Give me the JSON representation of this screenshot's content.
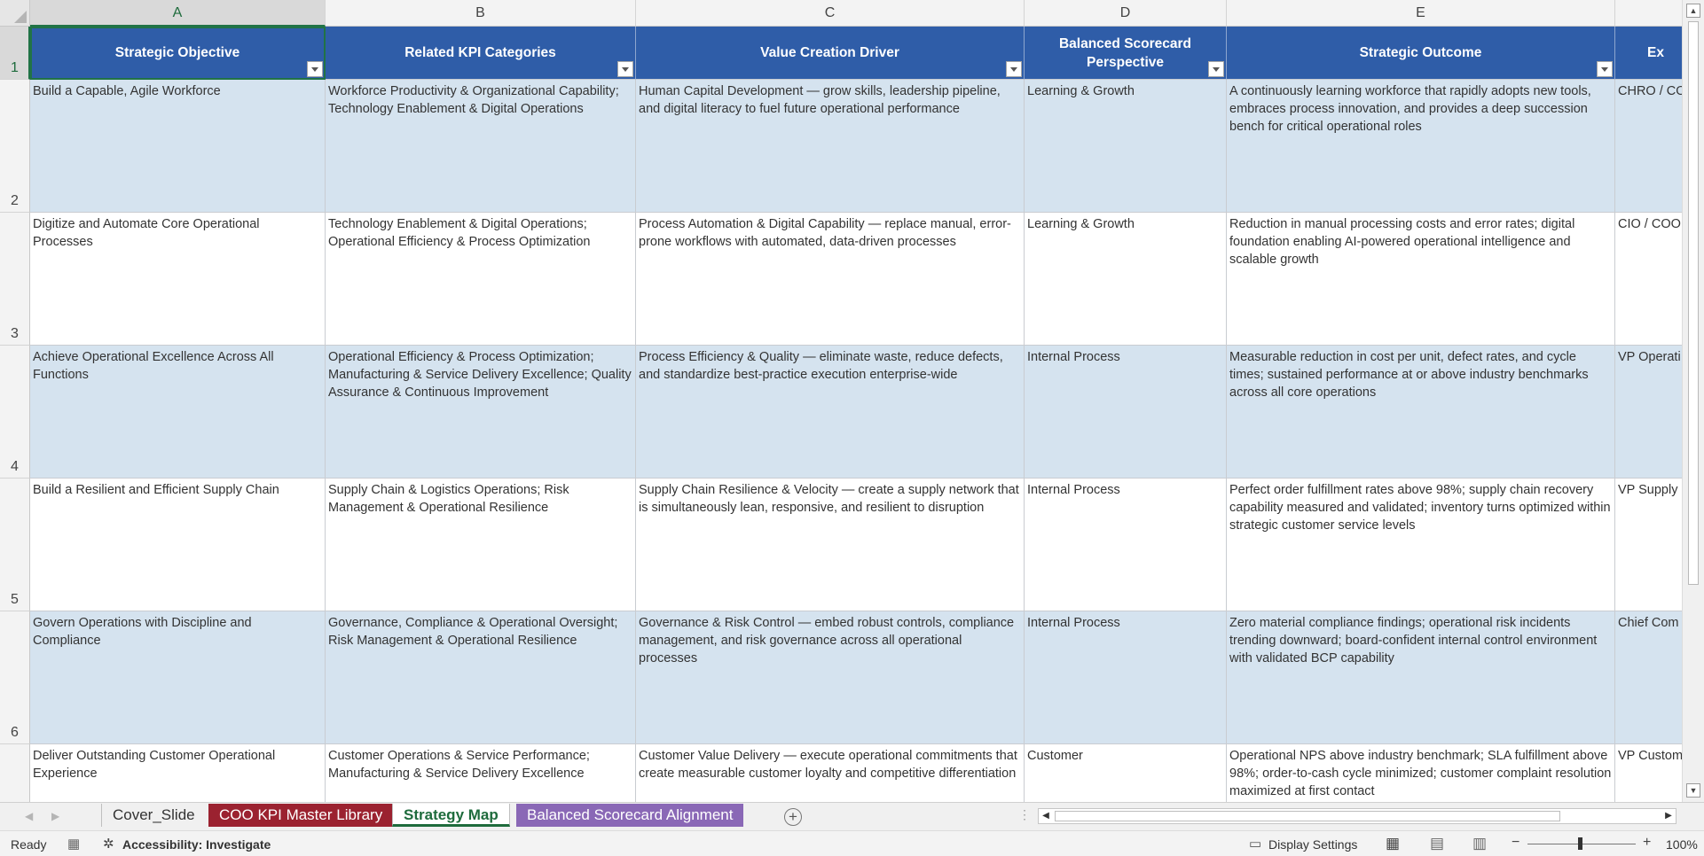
{
  "columns": [
    {
      "letter": "A",
      "header": "Strategic Objective"
    },
    {
      "letter": "B",
      "header": "Related KPI Categories"
    },
    {
      "letter": "C",
      "header": "Value Creation Driver"
    },
    {
      "letter": "D",
      "header": "Balanced Scorecard Perspective"
    },
    {
      "letter": "E",
      "header": "Strategic Outcome"
    },
    {
      "letter": "",
      "header": "Ex"
    }
  ],
  "row_numbers": [
    "1",
    "2",
    "3",
    "4",
    "5",
    "6"
  ],
  "rows": [
    {
      "objective": "Build a Capable, Agile Workforce",
      "kpi": "Workforce Productivity & Organizational Capability; Technology Enablement & Digital Operations",
      "driver": "Human Capital Development — grow skills, leadership pipeline, and digital literacy to fuel future operational performance",
      "perspective": "Learning & Growth",
      "outcome": "A continuously learning workforce that rapidly adopts new tools, embraces process innovation, and provides a deep succession bench for critical operational roles",
      "exec": "CHRO / CO"
    },
    {
      "objective": "Digitize and Automate Core Operational Processes",
      "kpi": "Technology Enablement & Digital Operations; Operational Efficiency & Process Optimization",
      "driver": "Process Automation & Digital Capability — replace manual, error-prone workflows with automated, data-driven processes",
      "perspective": "Learning & Growth",
      "outcome": "Reduction in manual processing costs and error rates; digital foundation enabling AI-powered operational intelligence and scalable growth",
      "exec": "CIO / COO"
    },
    {
      "objective": "Achieve Operational Excellence Across All Functions",
      "kpi": "Operational Efficiency & Process Optimization; Manufacturing & Service Delivery Excellence; Quality Assurance & Continuous Improvement",
      "driver": "Process Efficiency & Quality — eliminate waste, reduce defects, and standardize best-practice execution enterprise-wide",
      "perspective": "Internal Process",
      "outcome": "Measurable reduction in cost per unit, defect rates, and cycle times; sustained performance at or above industry benchmarks across all core operations",
      "exec": "VP Operati"
    },
    {
      "objective": "Build a Resilient and Efficient Supply Chain",
      "kpi": "Supply Chain & Logistics Operations; Risk Management & Operational Resilience",
      "driver": "Supply Chain Resilience & Velocity — create a supply network that is simultaneously lean, responsive, and resilient to disruption",
      "perspective": "Internal Process",
      "outcome": "Perfect order fulfillment rates above 98%; supply chain recovery capability measured and validated; inventory turns optimized within strategic customer service levels",
      "exec": "VP Supply"
    },
    {
      "objective": "Govern Operations with Discipline and Compliance",
      "kpi": "Governance, Compliance & Operational Oversight; Risk Management & Operational Resilience",
      "driver": "Governance & Risk Control — embed robust controls, compliance management, and risk governance across all operational processes",
      "perspective": "Internal Process",
      "outcome": "Zero material compliance findings; operational risk incidents trending downward; board-confident internal control environment with validated BCP capability",
      "exec": "Chief Com"
    },
    {
      "objective": "Deliver Outstanding Customer Operational Experience",
      "kpi": "Customer Operations & Service Performance; Manufacturing & Service Delivery Excellence",
      "driver": "Customer Value Delivery — execute operational commitments that create measurable customer loyalty and competitive differentiation",
      "perspective": "Customer",
      "outcome": "Operational NPS above industry benchmark; SLA fulfillment above 98%; order-to-cash cycle minimized; customer complaint resolution maximized at first contact",
      "exec": "VP Custom"
    }
  ],
  "sheets": [
    {
      "name": "Cover_Slide",
      "style": "plain"
    },
    {
      "name": "COO KPI Master Library",
      "style": "red"
    },
    {
      "name": "Strategy Map",
      "style": "active"
    },
    {
      "name": "Balanced Scorecard Alignment",
      "style": "purple"
    }
  ],
  "status": {
    "ready": "Ready",
    "accessibility": "Accessibility: Investigate",
    "display_settings": "Display Settings",
    "zoom": "100%"
  },
  "colors": {
    "header_blue": "#2f5da8",
    "band_blue": "#d5e3ef",
    "excel_green": "#217346",
    "tab_red": "#9b2230",
    "tab_purple": "#8a68b6"
  }
}
